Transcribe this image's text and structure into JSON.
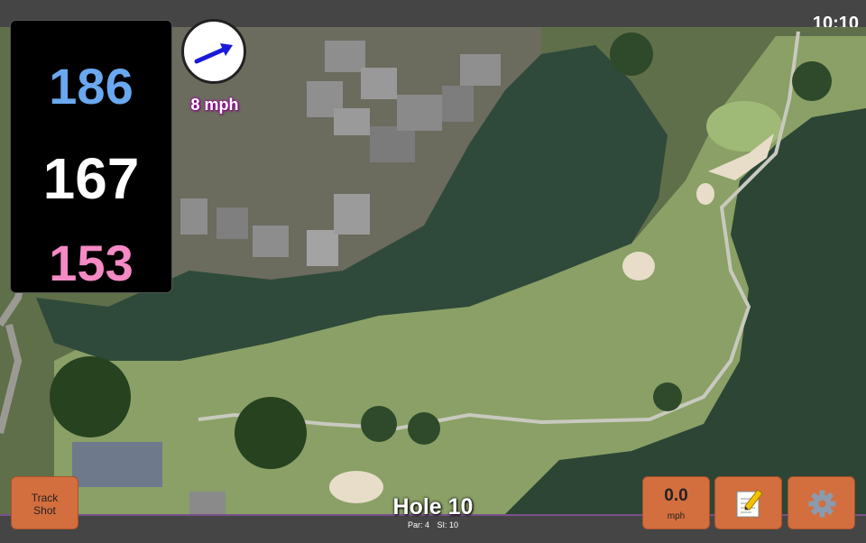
{
  "status": {
    "time": "10:10"
  },
  "distances": {
    "back": "186",
    "middle": "167",
    "front": "153"
  },
  "wind": {
    "speed": "8 mph",
    "direction_icon": "arrow-icon"
  },
  "buttons": {
    "track_shot": "Track\nShot",
    "speed_value": "0.0",
    "speed_unit": "mph",
    "notes_icon": "notepad-icon",
    "settings_icon": "gear-icon"
  },
  "hole": {
    "title": "Hole 10",
    "par": "Par: 4",
    "si": "SI: 10"
  },
  "colors": {
    "back": "#6aa8f0",
    "middle": "#ffffff",
    "front": "#f58ac4",
    "button": "#d36e3e",
    "accent": "#7a4f8a"
  }
}
